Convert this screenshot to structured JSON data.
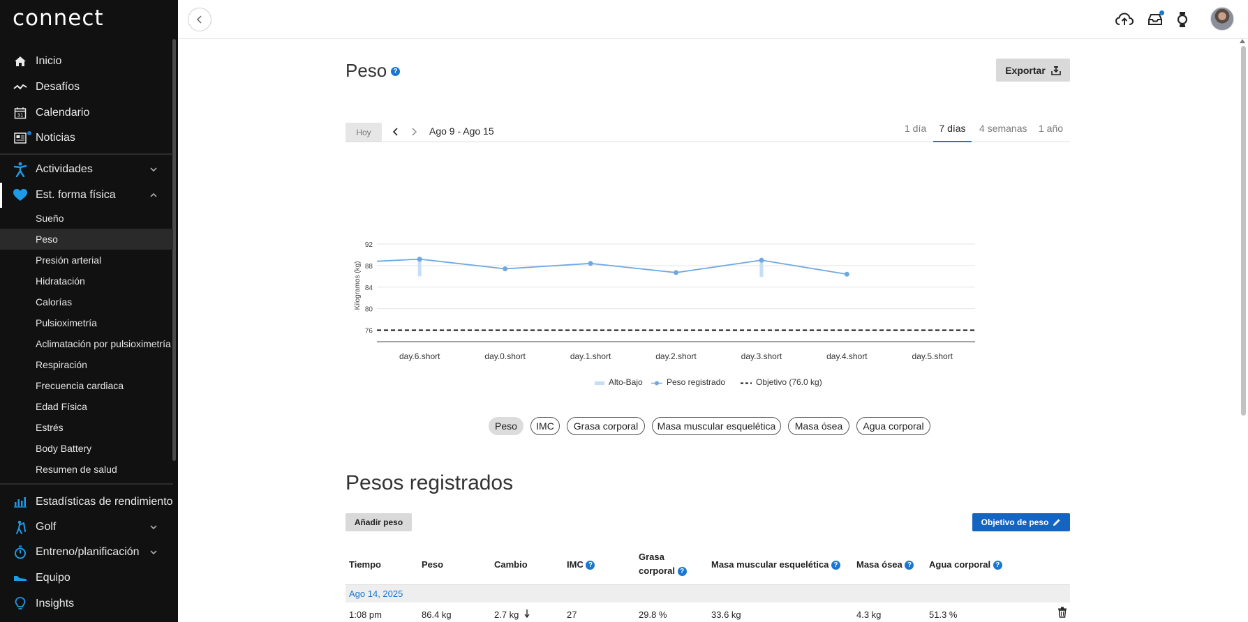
{
  "brand": {
    "logo": "connect"
  },
  "sidebar": {
    "main_items": [
      {
        "label": "Inicio",
        "icon": "home-icon"
      },
      {
        "label": "Desafíos",
        "icon": "challenge-icon"
      },
      {
        "label": "Calendario",
        "icon": "calendar-icon",
        "icon_text": "31"
      },
      {
        "label": "Noticias",
        "icon": "news-icon"
      }
    ],
    "group_items": [
      {
        "label": "Actividades",
        "icon": "running-person-icon"
      },
      {
        "label": "Est. forma física",
        "icon": "heart-icon"
      }
    ],
    "sub_items": [
      "Sueño",
      "Peso",
      "Presión arterial",
      "Hidratación",
      "Calorías",
      "Pulsioximetría",
      "Aclimatación por pulsioximetría",
      "Respiración",
      "Frecuencia cardiaca",
      "Edad Física",
      "Estrés",
      "Body Battery",
      "Resumen de salud"
    ],
    "selected_sub": "Peso",
    "bottom_items": [
      {
        "label": "Estadísticas de rendimiento",
        "icon": "bar-chart-icon"
      },
      {
        "label": "Golf",
        "icon": "golfer-icon"
      },
      {
        "label": "Entreno/planificación",
        "icon": "stopwatch-icon"
      },
      {
        "label": "Equipo",
        "icon": "shoe-icon"
      },
      {
        "label": "Insights",
        "icon": "lightbulb-icon"
      }
    ]
  },
  "page": {
    "title": "Peso",
    "export_label": "Exportar",
    "today_label": "Hoy",
    "date_range": "Ago 9 - Ago 15",
    "range_tabs": [
      "1 día",
      "7 días",
      "4 semanas",
      "1 año"
    ],
    "active_range": "7 días",
    "metric_tabs": [
      "Peso",
      "IMC",
      "Grasa corporal",
      "Masa muscular esquelética",
      "Masa ósea",
      "Agua corporal"
    ],
    "active_metric": "Peso"
  },
  "chart_data": {
    "type": "line",
    "ylabel": "Kilogramos (kg)",
    "y_ticks": [
      92,
      88,
      84,
      80,
      76
    ],
    "ylim": [
      74,
      92
    ],
    "categories": [
      "day.6.short",
      "day.0.short",
      "day.1.short",
      "day.2.short",
      "day.3.short",
      "day.4.short",
      "day.5.short"
    ],
    "series": [
      {
        "name": "Peso registrado",
        "values": [
          89.2,
          87.4,
          88.4,
          86.7,
          89.0,
          86.4,
          null
        ],
        "color": "#6fa8e0"
      }
    ],
    "leading_value": 88.8,
    "high_low": [
      [
        86.0,
        89.3
      ],
      null,
      null,
      null,
      [
        85.9,
        89.1
      ],
      null,
      null
    ],
    "goal": {
      "value": 76.0,
      "label": "Objetivo (76.0 kg)"
    },
    "legend": [
      "Alto-Bajo",
      "Peso registrado",
      "Objetivo (76.0 kg)"
    ],
    "legend_position": "bottom",
    "grid": true
  },
  "records": {
    "title": "Pesos registrados",
    "add_label": "Añadir peso",
    "goal_label": "Objetivo de peso",
    "headers": {
      "time": "Tiempo",
      "weight": "Peso",
      "change": "Cambio",
      "bmi": "IMC",
      "fat_line1": "Grasa",
      "fat_line2": "corporal",
      "muscle": "Masa muscular esquelética",
      "bone": "Masa ósea",
      "water": "Agua corporal"
    },
    "date_group": "Ago 14, 2025",
    "row": {
      "time": "1:08 pm",
      "weight": "86.4 kg",
      "change": "2.7 kg",
      "bmi": "27",
      "fat": "29.8 %",
      "muscle": "33.6 kg",
      "bone": "4.3 kg",
      "water": "51.3 %"
    }
  },
  "colors": {
    "accent": "#1976d2",
    "sidebar_bg": "#111111",
    "goal_button": "#1565c0"
  }
}
